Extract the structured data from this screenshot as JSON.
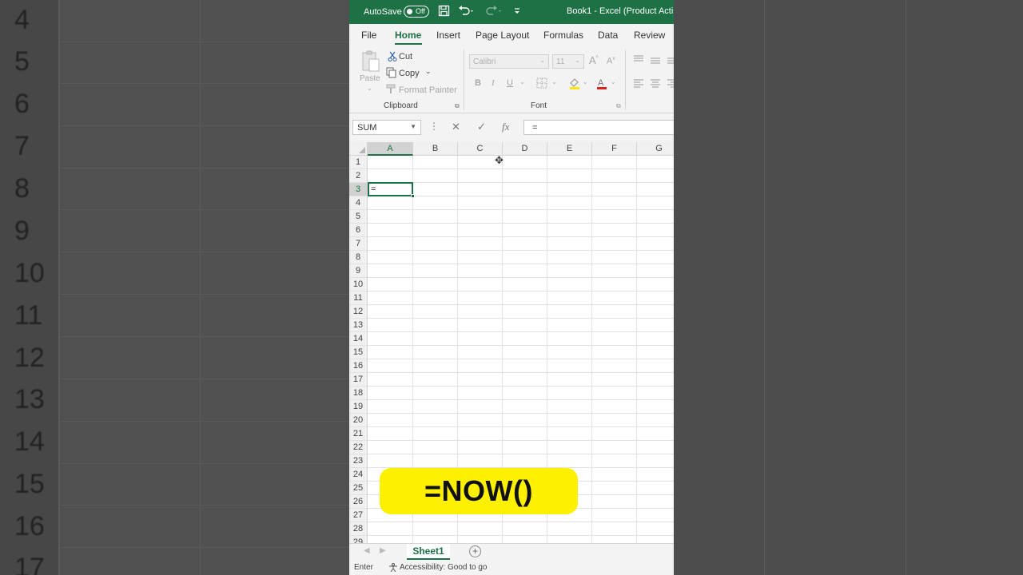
{
  "background": {
    "row_numbers": [
      "4",
      "5",
      "6",
      "7",
      "8",
      "9",
      "10",
      "11",
      "12",
      "13",
      "14",
      "15",
      "16",
      "17"
    ]
  },
  "titlebar": {
    "autosave_label": "AutoSave",
    "toggle_state": "Off",
    "document_title": "Book1 - Excel (Product Acti",
    "icons": [
      "save-icon",
      "undo-icon",
      "redo-icon",
      "customize-icon"
    ]
  },
  "menu": {
    "tabs": [
      "File",
      "Home",
      "Insert",
      "Page Layout",
      "Formulas",
      "Data",
      "Review"
    ],
    "active_tab": "Home"
  },
  "ribbon": {
    "paste_label": "Paste",
    "cut_label": "Cut",
    "copy_label": "Copy",
    "format_painter_label": "Format Painter",
    "clipboard_group": "Clipboard",
    "font_group": "Font",
    "font_name": "Calibri",
    "font_size": "11",
    "bold": "B",
    "italic": "I",
    "underline": "U"
  },
  "formula_bar": {
    "name_box": "SUM",
    "cancel_icon": "✕",
    "enter_icon": "✓",
    "function_icon": "fx",
    "value": "="
  },
  "grid": {
    "columns": [
      "A",
      "B",
      "C",
      "D",
      "E",
      "F",
      "G"
    ],
    "selected_column": "A",
    "rows": [
      "1",
      "2",
      "3",
      "4",
      "5",
      "6",
      "7",
      "8",
      "9",
      "10",
      "11",
      "12",
      "13",
      "14",
      "15",
      "16",
      "17",
      "18",
      "19",
      "20",
      "21",
      "22",
      "23",
      "24",
      "25",
      "26",
      "27",
      "28",
      "29"
    ],
    "selected_row": "3",
    "active_cell_value": "="
  },
  "overlay": {
    "caption": "=NOW()",
    "color": "#fdf000"
  },
  "sheets": {
    "tabs": [
      "Sheet1"
    ],
    "add_label": "+"
  },
  "status": {
    "mode": "Enter",
    "accessibility": "Accessibility: Good to go"
  },
  "colors": {
    "excel_green": "#1e7145"
  }
}
